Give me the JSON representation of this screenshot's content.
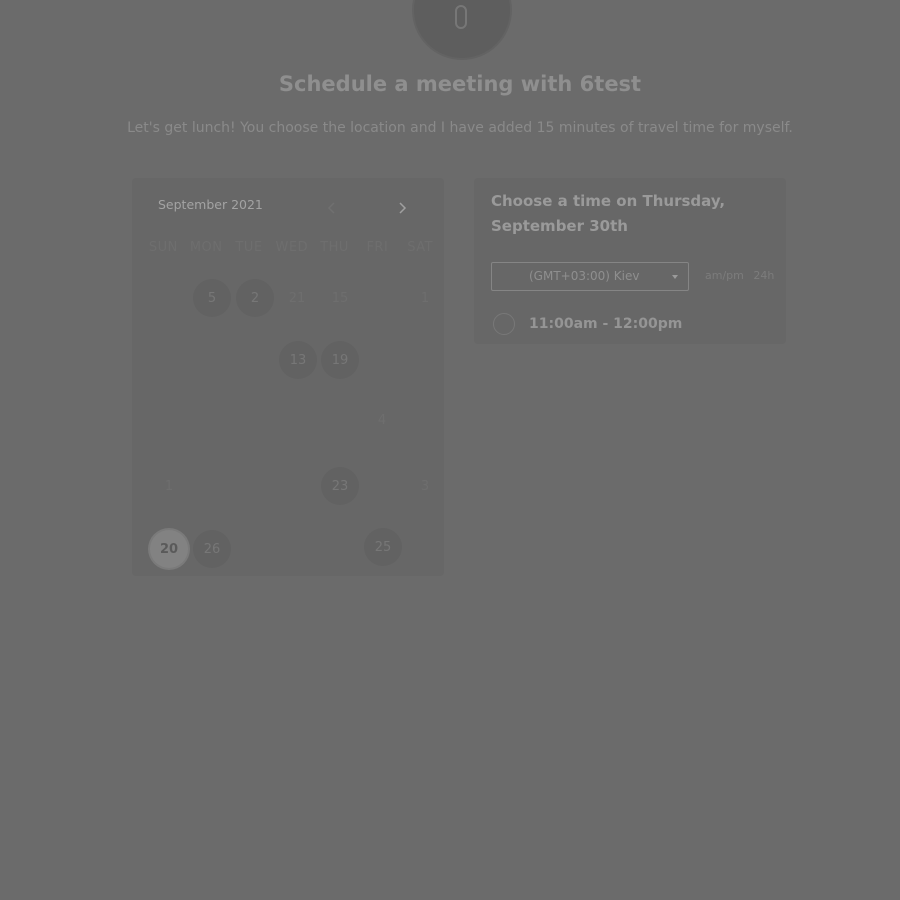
{
  "header": {
    "title": "Schedule a meeting with 6test",
    "subtitle": "Let's get lunch! You choose the location and I have added 15 minutes of travel time for myself."
  },
  "calendar": {
    "month": "September 2021",
    "prev_icon": "chevron-left-icon",
    "next_icon": "chevron-right-icon",
    "weekdays": [
      "SUN",
      "MON",
      "TUE",
      "WED",
      "THU",
      "FRI",
      "SAT"
    ],
    "days": {
      "d1": "5",
      "d2": "2",
      "d3": "21",
      "d4": "15",
      "d5": "1",
      "d6": "13",
      "d7": "19",
      "d8": "4",
      "d9": "1",
      "d10": "23",
      "d11": "3",
      "d12": "20",
      "d13": "26",
      "d14": "25"
    },
    "selected_day": "20"
  },
  "time_panel": {
    "heading": "Choose a time on Thursday, September 30th",
    "timezone": "(GMT+03:00) Kiev",
    "format_12h": "am/pm",
    "format_24h": "24h",
    "slots": [
      "11:00am - 12:00pm"
    ]
  },
  "colors": {
    "overlay": "#6b6b6b"
  }
}
